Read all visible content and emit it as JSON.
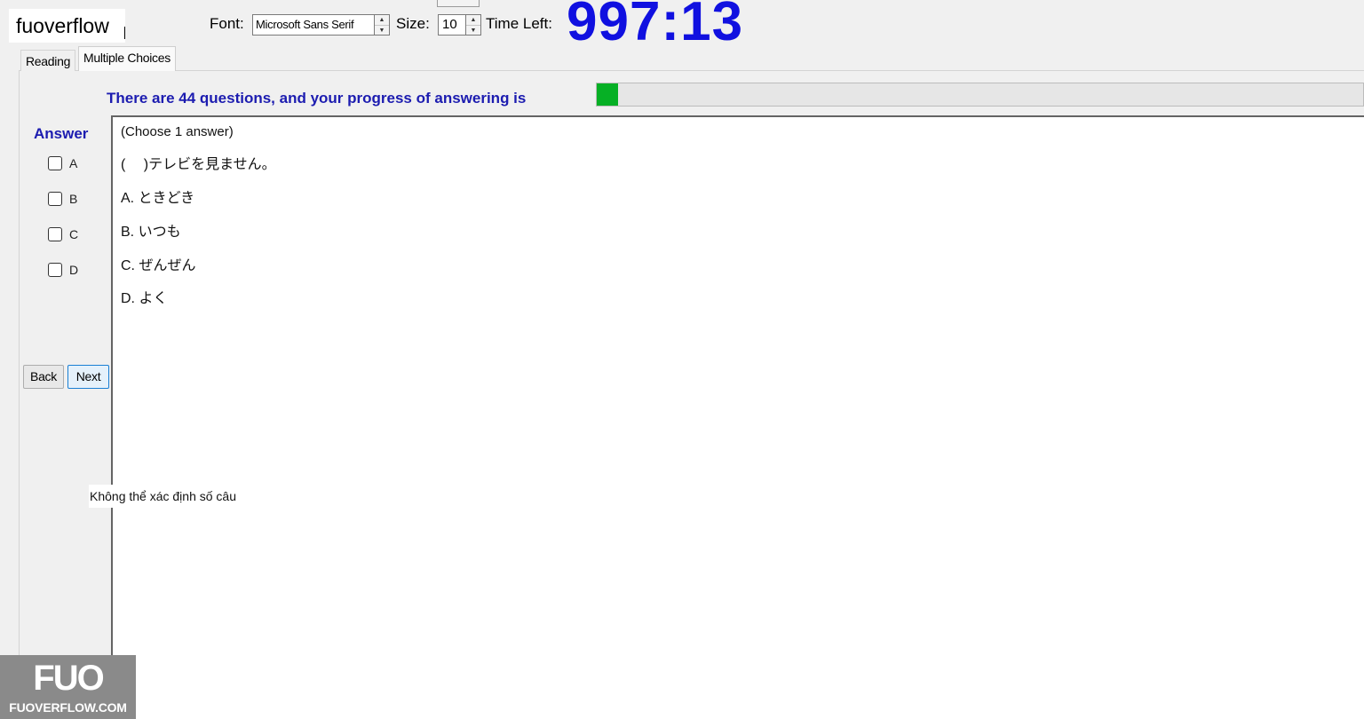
{
  "topbar": {
    "input_text": "fuoverflow",
    "font_label": "Font:",
    "font_value": "Microsoft Sans Serif",
    "size_label": "Size:",
    "size_value": "10",
    "time_label": "Time Left:",
    "time_value": "997:13"
  },
  "tabs": [
    {
      "label": "Reading",
      "selected": false
    },
    {
      "label": "Multiple Choices",
      "selected": true
    }
  ],
  "progress": {
    "text": "There are 44 questions, and your progress of answering is",
    "fraction": 0.028,
    "fill_color": "#06b025"
  },
  "answer": {
    "title": "Answer",
    "options": [
      {
        "label": "A",
        "checked": false
      },
      {
        "label": "B",
        "checked": false
      },
      {
        "label": "C",
        "checked": false
      },
      {
        "label": "D",
        "checked": false
      }
    ]
  },
  "nav": {
    "back_label": "Back",
    "next_label": "Next"
  },
  "question": {
    "instruction": "(Choose 1 answer)",
    "stem": "(　 )テレビを見ません。",
    "choices": [
      "A. ときどき",
      "B. いつも",
      "C. ぜんぜん",
      "D. よく"
    ]
  },
  "status": "Không thể xác định số câu",
  "logo": {
    "mark": "FUO",
    "sub": "FUOVERFLOW.COM"
  },
  "colors": {
    "accent_blue": "#1010e0",
    "label_blue": "#1c1cb0"
  }
}
